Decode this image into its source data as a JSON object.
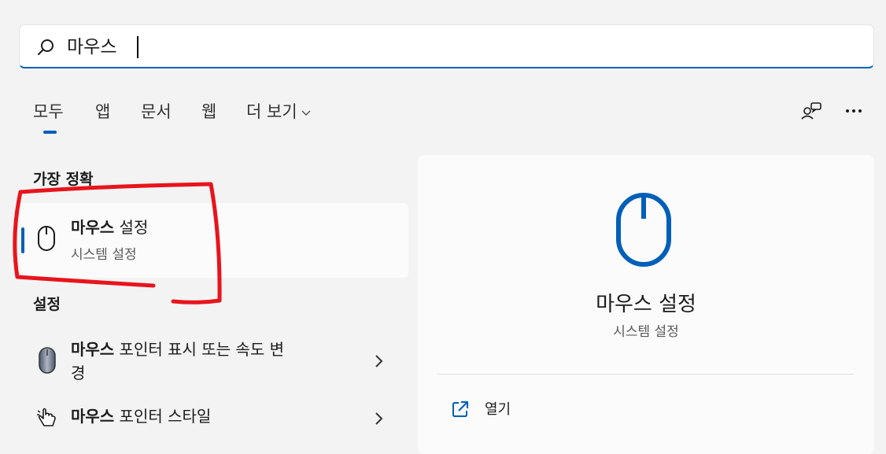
{
  "search": {
    "query": "마우스"
  },
  "tabs": [
    {
      "label": "모두",
      "active": true
    },
    {
      "label": "앱"
    },
    {
      "label": "문서"
    },
    {
      "label": "웹"
    },
    {
      "label": "더 보기"
    }
  ],
  "toolbar": {
    "feedback_icon": "feedback-icon",
    "more_icon": "more-options-icon"
  },
  "best_match": {
    "section_title": "가장 정확",
    "item": {
      "title_bold": "마우스",
      "title_rest": " 설정",
      "subtitle": "시스템 설정"
    }
  },
  "settings": {
    "section_title": "설정",
    "items": [
      {
        "title_bold": "마우스",
        "title_rest_line1": " 포인터 표시 또는 속도 변",
        "title_rest_line2": "경"
      },
      {
        "title_bold": "마우스",
        "title_rest_line1": " 포인터 스타일"
      }
    ]
  },
  "detail": {
    "title": "마우스 설정",
    "subtitle": "시스템 설정",
    "actions": [
      {
        "label": "열기"
      }
    ]
  },
  "colors": {
    "accent": "#005fb8",
    "annotation": "#e8141c"
  }
}
